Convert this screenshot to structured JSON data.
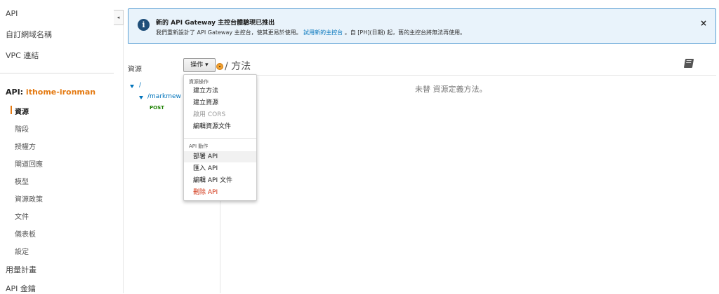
{
  "sidebar": {
    "top_items": [
      {
        "label": "API"
      },
      {
        "label": "自訂網域名稱"
      },
      {
        "label": "VPC 連結"
      }
    ],
    "api_prefix": "API:",
    "api_name": "ithome-ironman",
    "sub_items": [
      {
        "label": "資源"
      },
      {
        "label": "階段"
      },
      {
        "label": "授權方"
      },
      {
        "label": "閘道回應"
      },
      {
        "label": "模型"
      },
      {
        "label": "資源政策"
      },
      {
        "label": "文件"
      },
      {
        "label": "儀表板"
      },
      {
        "label": "設定"
      }
    ],
    "bottom_items": [
      {
        "label": "用量計畫"
      },
      {
        "label": "API 金鑰"
      }
    ],
    "collapse_glyph": "◂"
  },
  "banner": {
    "icon": "info-icon",
    "title": "新的 API Gateway 主控台體驗現已推出",
    "message_pre": "我們重新設計了 API Gateway 主控台，使其更易於使用。",
    "link": "試用新的主控台",
    "message_post": "。自 [PH](日期) 起，舊的主控台將無法再使用。",
    "close": "×"
  },
  "resources": {
    "label": "資源",
    "actions_label": "操作 ▾",
    "methods_title": "/ 方法",
    "empty_message": "未替 資源定義方法。",
    "tree": {
      "root": "/",
      "child": "/markmew",
      "method": "POST"
    }
  },
  "actions_menu": {
    "resource_header": "資源操作",
    "resource_items": [
      {
        "label": "建立方法",
        "state": "normal"
      },
      {
        "label": "建立資源",
        "state": "normal"
      },
      {
        "label": "啟用 CORS",
        "state": "disabled"
      },
      {
        "label": "編輯資源文件",
        "state": "normal"
      }
    ],
    "api_header": "API 動作",
    "api_items": [
      {
        "label": "部署 API",
        "state": "hover"
      },
      {
        "label": "匯入 API",
        "state": "normal"
      },
      {
        "label": "編輯 API 文件",
        "state": "normal"
      },
      {
        "label": "刪除 API",
        "state": "danger"
      }
    ]
  },
  "colors": {
    "accent": "#e47911",
    "link": "#0073bb",
    "danger": "#d13212",
    "post": "#1d8102",
    "banner_bg": "#e9f3fb",
    "banner_border": "#5a9fd4"
  }
}
